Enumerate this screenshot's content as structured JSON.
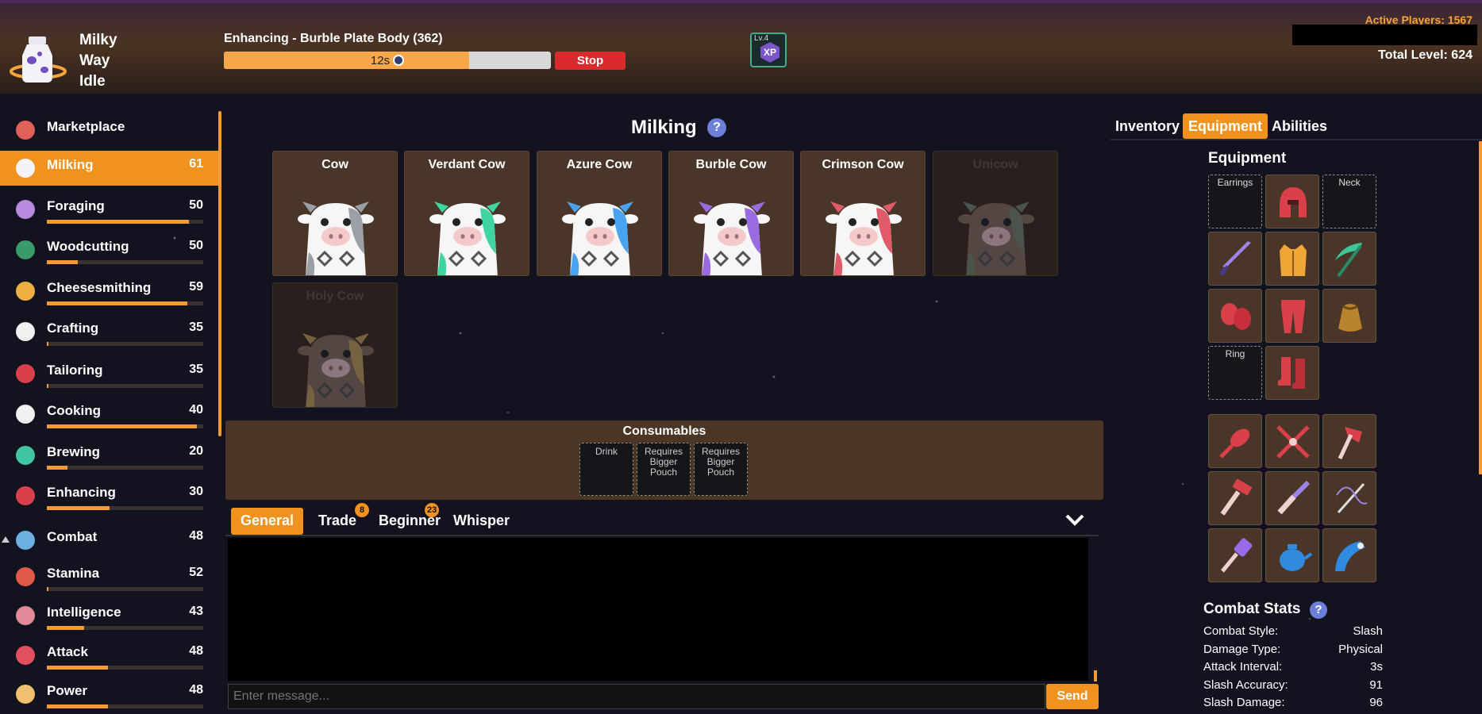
{
  "app": {
    "name_lines": [
      "Milky",
      "Way",
      "Idle"
    ]
  },
  "header": {
    "action_title": "Enhancing - Burble Plate Body (362)",
    "progress_time": "12s",
    "progress_fraction": 0.75,
    "stop_label": "Stop",
    "xp_level": "Lv.4",
    "xp_label": "XP",
    "active_players": "Active Players: 1567",
    "total_level": "Total Level: 624"
  },
  "sidebar": {
    "items": [
      {
        "label": "Marketplace",
        "level": "",
        "fill": null,
        "icon": "market-stall-icon"
      },
      {
        "label": "Milking",
        "level": "61",
        "fill": null,
        "icon": "milk-bottle-icon"
      },
      {
        "label": "Foraging",
        "level": "50",
        "fill": 0.91,
        "icon": "mushroom-icon"
      },
      {
        "label": "Woodcutting",
        "level": "50",
        "fill": 0.2,
        "icon": "tree-icon"
      },
      {
        "label": "Cheesesmithing",
        "level": "59",
        "fill": 0.9,
        "icon": "hammer-icon"
      },
      {
        "label": "Crafting",
        "level": "35",
        "fill": 0.01,
        "icon": "origami-crane-icon"
      },
      {
        "label": "Tailoring",
        "level": "35",
        "fill": 0.01,
        "icon": "shirt-icon"
      },
      {
        "label": "Cooking",
        "level": "40",
        "fill": 0.96,
        "icon": "chef-hat-icon"
      },
      {
        "label": "Brewing",
        "level": "20",
        "fill": 0.13,
        "icon": "teacup-icon"
      },
      {
        "label": "Enhancing",
        "level": "30",
        "fill": 0.4,
        "icon": "enhance-icon"
      },
      {
        "label": "Combat",
        "level": "48",
        "fill": null,
        "icon": "crossed-swords-icon"
      },
      {
        "label": "Stamina",
        "level": "52",
        "fill": 0.01,
        "icon": "heart-icon"
      },
      {
        "label": "Intelligence",
        "level": "43",
        "fill": 0.24,
        "icon": "brain-icon"
      },
      {
        "label": "Attack",
        "level": "48",
        "fill": 0.39,
        "icon": "dagger-icon"
      },
      {
        "label": "Power",
        "level": "48",
        "fill": 0.39,
        "icon": "fist-icon"
      }
    ]
  },
  "main": {
    "title": "Milking",
    "help": "?",
    "cows": [
      {
        "name": "Cow",
        "color": "#9aa0a6",
        "locked": false
      },
      {
        "name": "Verdant Cow",
        "color": "#3fd4a0",
        "locked": false
      },
      {
        "name": "Azure Cow",
        "color": "#4aa3f0",
        "locked": false
      },
      {
        "name": "Burble Cow",
        "color": "#9a6ae0",
        "locked": false
      },
      {
        "name": "Crimson Cow",
        "color": "#e05a6a",
        "locked": false
      },
      {
        "name": "Unicow",
        "color": "#7a8a70",
        "locked": true
      },
      {
        "name": "Holy Cow",
        "color": "#c9a45a",
        "locked": true
      }
    ],
    "consumables": {
      "title": "Consumables",
      "slots": [
        "Drink",
        "Requires Bigger Pouch",
        "Requires Bigger Pouch"
      ]
    }
  },
  "chat": {
    "tabs": [
      {
        "label": "General",
        "badge": ""
      },
      {
        "label": "Trade",
        "badge": "8"
      },
      {
        "label": "Beginner",
        "badge": "23"
      },
      {
        "label": "Whisper",
        "badge": ""
      }
    ],
    "placeholder": "Enter message...",
    "send_label": "Send"
  },
  "right_panel": {
    "tabs": [
      "Inventory",
      "Equipment",
      "Abilities"
    ],
    "equipment_title": "Equipment",
    "slot_labels": {
      "earrings": "Earrings",
      "neck": "Neck",
      "ring": "Ring"
    },
    "equipped_icons": [
      "red-helmet-icon",
      "purple-sword-icon",
      "golden-vest-icon",
      "green-scythe-icon",
      "red-gloves-icon",
      "red-plate-legs-icon",
      "pouch-icon",
      "red-boots-icon"
    ],
    "tool_icons": [
      "red-brush-icon",
      "red-shears-icon",
      "red-hatchet-icon",
      "red-hammer-icon",
      "purple-chisel-icon",
      "needle-thread-icon",
      "purple-spatula-icon",
      "blue-teapot-icon",
      "blue-enhancer-icon"
    ],
    "combat_title": "Combat Stats",
    "stats": [
      {
        "label": "Combat Style:",
        "value": "Slash"
      },
      {
        "label": "Damage Type:",
        "value": "Physical"
      },
      {
        "label": "Attack Interval:",
        "value": "3s"
      },
      {
        "label": "Slash Accuracy:",
        "value": "91"
      },
      {
        "label": "Slash Damage:",
        "value": "96"
      }
    ]
  },
  "colors": {
    "accent": "#f0921e",
    "stop": "#d92b2b",
    "panel": "#4a3628"
  }
}
